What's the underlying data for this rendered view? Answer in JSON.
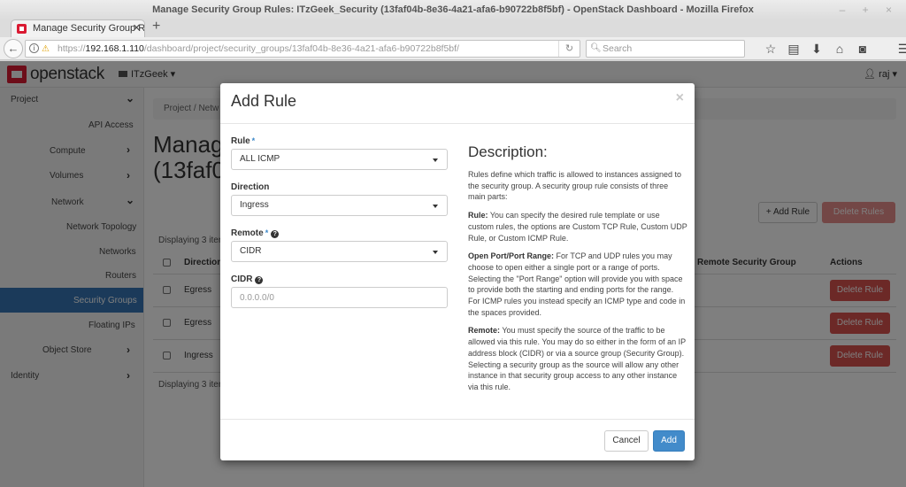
{
  "window": {
    "title": "Manage Security Group Rules: ITzGeek_Security (13faf04b-8e36-4a21-afa6-b90722b8f5bf) - OpenStack Dashboard - Mozilla Firefox",
    "controls": "– + ×"
  },
  "browser": {
    "tab_label": "Manage Security Group Rul",
    "tab_close": "✕",
    "new_tab": "+",
    "back": "←",
    "url_scheme": "https://",
    "url_host": "192.168.1.110",
    "url_path": "/dashboard/project/security_groups/13faf04b-8e36-4a21-afa6-b90722b8f5bf/",
    "reload": "↻",
    "search_placeholder": "Search",
    "icons": [
      "star-icon",
      "reading-list-icon",
      "download-icon",
      "home-icon",
      "pocket-icon",
      "menu-icon"
    ]
  },
  "topnav": {
    "logo_text": "openstack",
    "project": "ITzGeek",
    "user": "raj"
  },
  "sidebar": {
    "items": [
      {
        "label": "Project",
        "chevron": "⌄"
      },
      {
        "label": "API Access"
      },
      {
        "label": "Compute",
        "chevron": "›"
      },
      {
        "label": "Volumes",
        "chevron": "›"
      },
      {
        "label": "Network",
        "chevron": "⌄"
      },
      {
        "label": "Network Topology"
      },
      {
        "label": "Networks"
      },
      {
        "label": "Routers"
      },
      {
        "label": "Security Groups",
        "active": true
      },
      {
        "label": "Floating IPs"
      },
      {
        "label": "Object Store",
        "chevron": "›"
      },
      {
        "label": "Identity",
        "chevron": "›"
      }
    ]
  },
  "main": {
    "breadcrumb": "Project /  Netw",
    "title_line1": "Manage",
    "title_line2": "(13faf0",
    "add_rule_label": "+ Add Rule",
    "delete_rules_label": "Delete Rules",
    "displaying_top": "Displaying 3 item",
    "displaying_bottom": "Displaying 3 item",
    "table": {
      "columns": [
        "Direction",
        "Remote Security Group",
        "Actions"
      ],
      "rows": [
        {
          "direction": "Egress",
          "action": "Delete Rule"
        },
        {
          "direction": "Egress",
          "action": "Delete Rule"
        },
        {
          "direction": "Ingress",
          "action": "Delete Rule"
        }
      ]
    }
  },
  "modal": {
    "title": "Add Rule",
    "close": "×",
    "fields": {
      "rule": {
        "label": "Rule",
        "required": "*",
        "value": "ALL ICMP"
      },
      "direction": {
        "label": "Direction",
        "value": "Ingress"
      },
      "remote": {
        "label": "Remote",
        "required": "*",
        "value": "CIDR"
      },
      "cidr": {
        "label": "CIDR",
        "placeholder": "0.0.0.0/0"
      }
    },
    "description": {
      "heading": "Description:",
      "intro": "Rules define which traffic is allowed to instances assigned to the security group. A security group rule consists of three main parts:",
      "rule_title": "Rule:",
      "rule_text": " You can specify the desired rule template or use custom rules, the options are Custom TCP Rule, Custom UDP Rule, or Custom ICMP Rule.",
      "port_title": "Open Port/Port Range:",
      "port_text": " For TCP and UDP rules you may choose to open either a single port or a range of ports. Selecting the \"Port Range\" option will provide you with space to provide both the starting and ending ports for the range. For ICMP rules you instead specify an ICMP type and code in the spaces provided.",
      "remote_title": "Remote:",
      "remote_text": " You must specify the source of the traffic to be allowed via this rule. You may do so either in the form of an IP address block (CIDR) or via a source group (Security Group). Selecting a security group as the source will allow any other instance in that security group access to any other instance via this rule."
    },
    "cancel_label": "Cancel",
    "add_label": "Add"
  },
  "colors": {
    "brand": "#da1a32",
    "primary": "#428bca",
    "danger": "#d9534f",
    "sidebar_active": "#3775b4"
  }
}
